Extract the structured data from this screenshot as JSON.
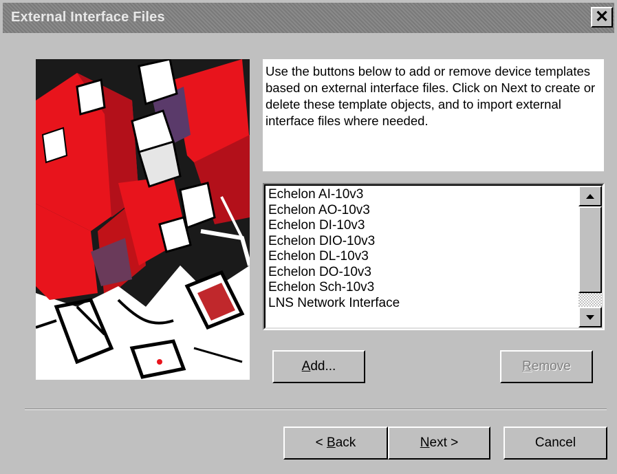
{
  "window": {
    "title": "External Interface Files",
    "close_symbol": "✕"
  },
  "description": "Use the buttons below to add or remove device templates based on external interface files. Click on Next to create or delete these template objects, and to import external interface files where needed.",
  "templates_list": {
    "items": [
      "Echelon AI-10v3",
      "Echelon AO-10v3",
      "Echelon DI-10v3",
      "Echelon DIO-10v3",
      "Echelon DL-10v3",
      "Echelon DO-10v3",
      "Echelon Sch-10v3",
      "LNS Network Interface"
    ]
  },
  "buttons": {
    "add": {
      "mnemonic": "A",
      "rest": "dd..."
    },
    "remove": {
      "mnemonic": "R",
      "rest": "emove",
      "enabled": false
    },
    "back": {
      "prefix": "< ",
      "mnemonic": "B",
      "rest": "ack"
    },
    "next": {
      "mnemonic": "N",
      "rest": "ext >"
    },
    "cancel": {
      "label": "Cancel"
    }
  },
  "icons": {
    "close": "close-icon",
    "scroll_up": "scroll-up-arrow-icon",
    "scroll_down": "scroll-down-arrow-icon",
    "wizard_image": "abstract-cubes-illustration"
  },
  "colors": {
    "dialog_bg": "#c0c0c0",
    "title_bar": "#7f7f7f",
    "illustration_red": "#e8141c"
  }
}
